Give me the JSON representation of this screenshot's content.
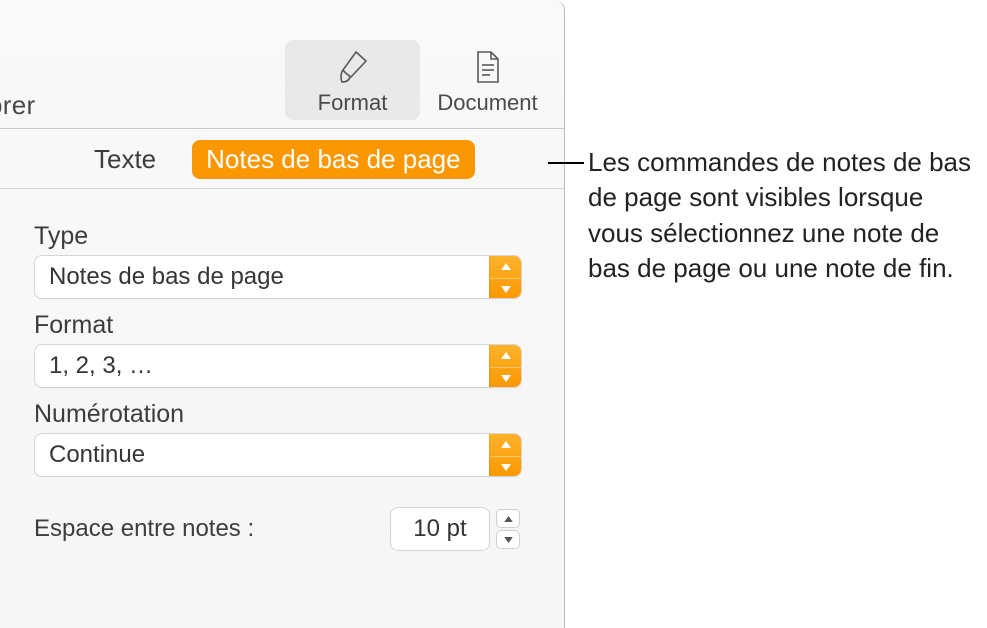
{
  "toolbar": {
    "truncated_left": "orer",
    "format_label": "Format",
    "document_label": "Document"
  },
  "tabs": {
    "text": "Texte",
    "footnotes": "Notes de bas de page"
  },
  "fields": {
    "type_label": "Type",
    "type_value": "Notes de bas de page",
    "format_label": "Format",
    "format_value": "1, 2, 3, …",
    "numbering_label": "Numérotation",
    "numbering_value": "Continue",
    "spacing_label": "Espace entre notes :",
    "spacing_value": "10 pt"
  },
  "callout": "Les commandes de notes de bas de page sont visibles lorsque vous sélectionnez une note de bas de page ou une note de fin.",
  "colors": {
    "accent": "#fb9700"
  }
}
